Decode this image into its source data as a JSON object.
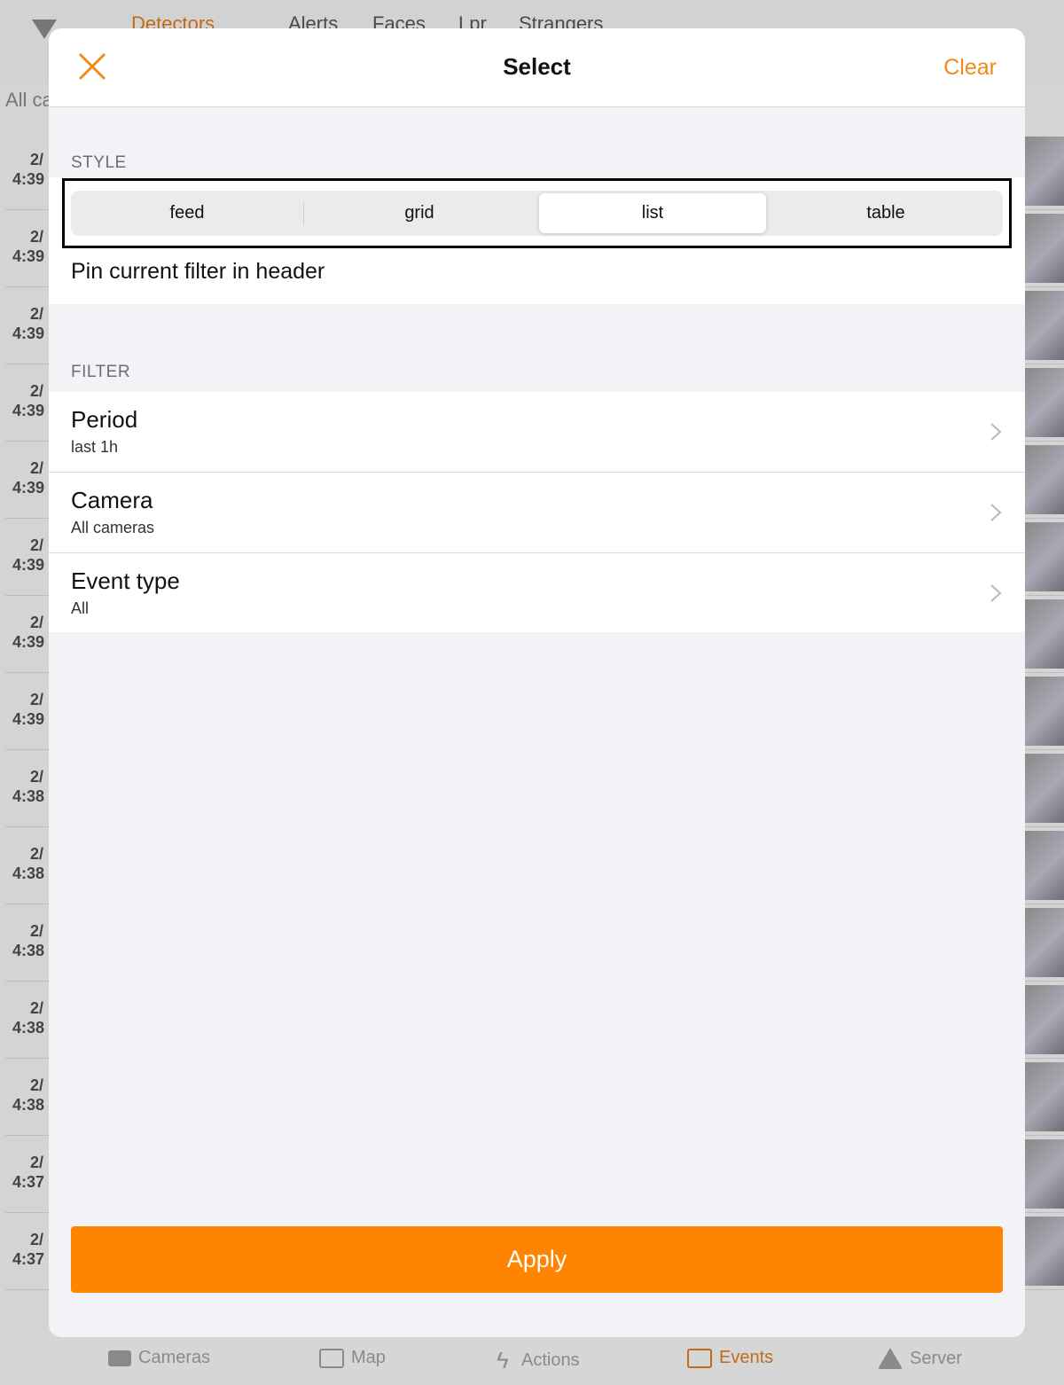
{
  "background": {
    "tabs": [
      {
        "label": "Detectors"
      },
      {
        "label": "Alerts"
      },
      {
        "label": "Faces"
      },
      {
        "label": "Lpr"
      },
      {
        "label": "Strangers"
      }
    ],
    "all_cameras_text": "All ca",
    "rows": [
      {
        "date": "2/",
        "time": "4:39"
      },
      {
        "date": "2/",
        "time": "4:39"
      },
      {
        "date": "2/",
        "time": "4:39"
      },
      {
        "date": "2/",
        "time": "4:39"
      },
      {
        "date": "2/",
        "time": "4:39"
      },
      {
        "date": "2/",
        "time": "4:39"
      },
      {
        "date": "2/",
        "time": "4:39"
      },
      {
        "date": "2/",
        "time": "4:39"
      },
      {
        "date": "2/",
        "time": "4:38"
      },
      {
        "date": "2/",
        "time": "4:38"
      },
      {
        "date": "2/",
        "time": "4:38"
      },
      {
        "date": "2/",
        "time": "4:38"
      },
      {
        "date": "2/",
        "time": "4:38"
      },
      {
        "date": "2/",
        "time": "4:37"
      },
      {
        "date": "2/",
        "time": "4:37"
      }
    ],
    "tabbar": [
      {
        "label": "Cameras",
        "icon": "camera-icon"
      },
      {
        "label": "Map",
        "icon": "map-icon"
      },
      {
        "label": "Actions",
        "icon": "bolt-icon"
      },
      {
        "label": "Events",
        "icon": "events-icon"
      },
      {
        "label": "Server",
        "icon": "home-icon"
      }
    ]
  },
  "modal": {
    "title": "Select",
    "clear_label": "Clear",
    "style_section": "STYLE",
    "style_options": [
      "feed",
      "grid",
      "list",
      "table"
    ],
    "selected_style": "list",
    "pin_label": "Pin current filter in header",
    "filter_section": "FILTER",
    "filters": [
      {
        "title": "Period",
        "value": "last 1h"
      },
      {
        "title": "Camera",
        "value": "All cameras"
      },
      {
        "title": "Event type",
        "value": "All"
      }
    ],
    "apply_label": "Apply"
  },
  "colors": {
    "accent": "#ff8400",
    "accent_text": "#f28a1a",
    "sheet_background": "#f2f2f7"
  }
}
